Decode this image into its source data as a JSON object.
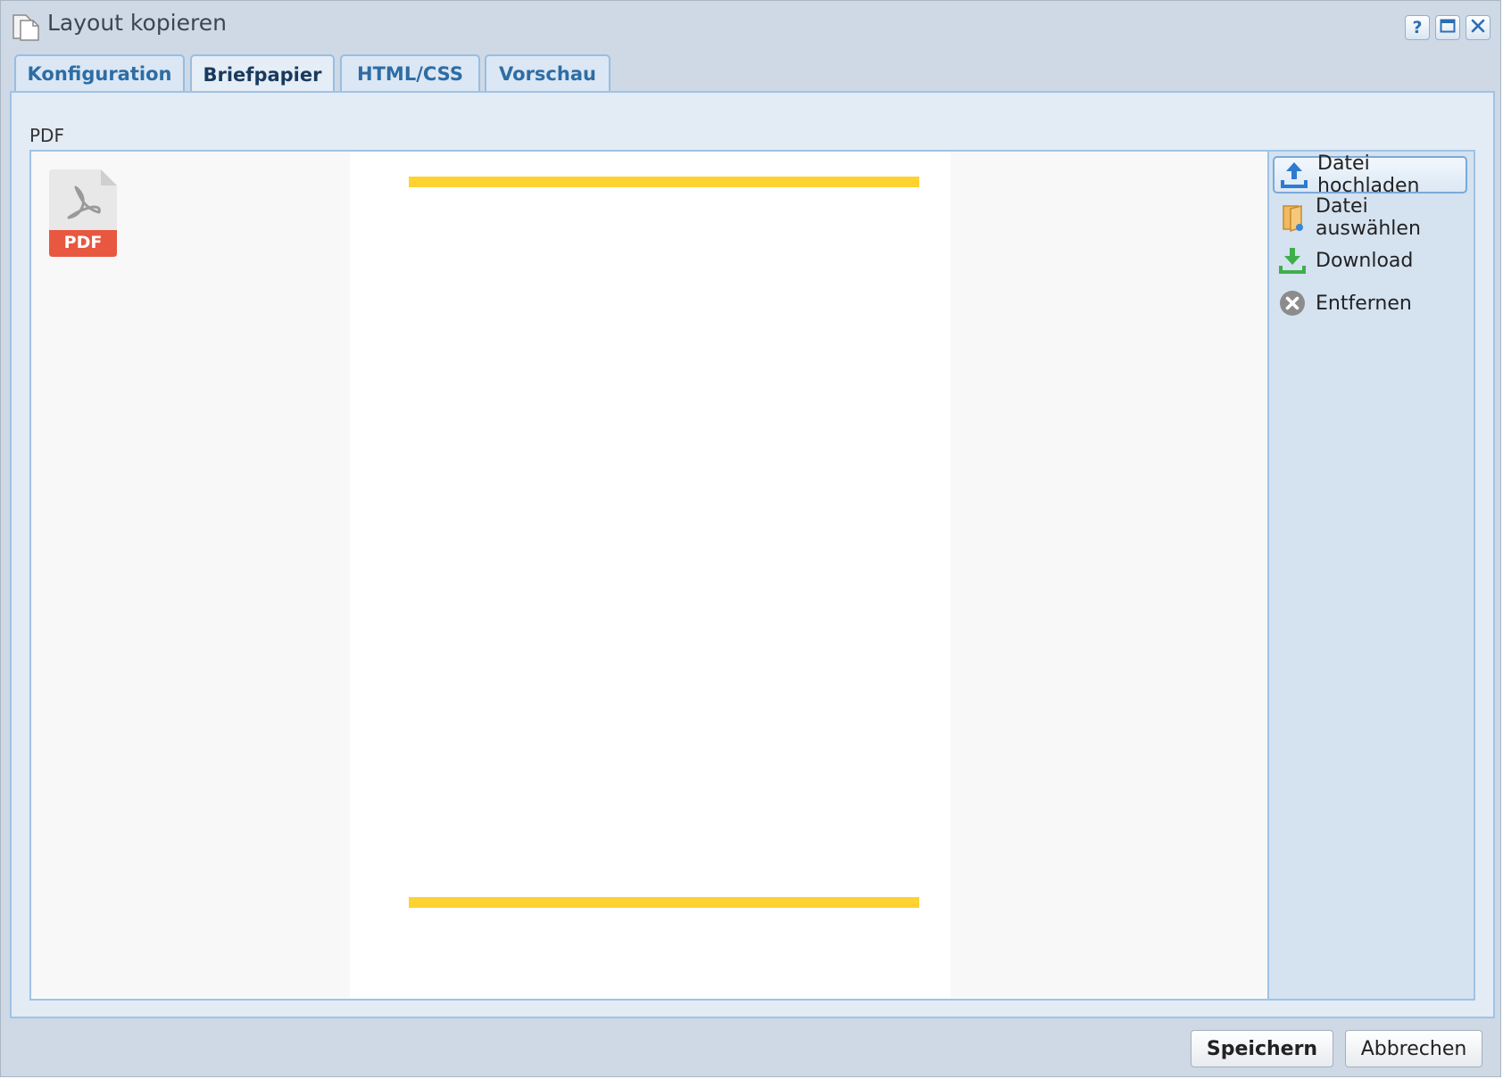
{
  "window": {
    "title": "Layout kopieren"
  },
  "tabs": [
    {
      "label": "Konfiguration",
      "active": false
    },
    {
      "label": "Briefpapier",
      "active": true
    },
    {
      "label": "HTML/CSS",
      "active": false
    },
    {
      "label": "Vorschau",
      "active": false
    }
  ],
  "panel": {
    "section_label": "PDF",
    "pdf_thumb_label": "PDF"
  },
  "sidebar": {
    "items": [
      {
        "label": "Datei hochladen",
        "icon": "upload-icon"
      },
      {
        "label": "Datei auswählen",
        "icon": "folder-icon"
      },
      {
        "label": "Download",
        "icon": "download-icon"
      },
      {
        "label": "Entfernen",
        "icon": "remove-icon"
      }
    ]
  },
  "footer": {
    "save_label": "Speichern",
    "cancel_label": "Abbrechen"
  },
  "colors": {
    "accent": "#2e6da4",
    "highlight_line": "#fdd231",
    "pdf_red": "#e8573f"
  }
}
